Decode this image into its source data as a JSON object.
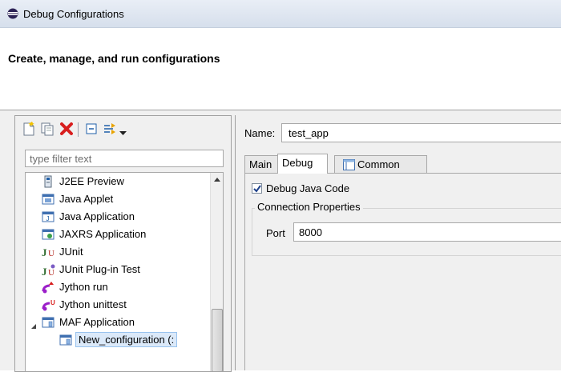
{
  "window": {
    "title": "Debug Configurations"
  },
  "header": {
    "heading": "Create, manage, and run configurations"
  },
  "left": {
    "filter_placeholder": "type filter text",
    "tree": [
      {
        "label": "J2EE Preview",
        "icon": "j2ee-preview-icon"
      },
      {
        "label": "Java Applet",
        "icon": "java-applet-icon"
      },
      {
        "label": "Java Application",
        "icon": "java-application-icon"
      },
      {
        "label": "JAXRS Application",
        "icon": "jaxrs-application-icon"
      },
      {
        "label": "JUnit",
        "icon": "junit-icon"
      },
      {
        "label": "JUnit Plug-in Test",
        "icon": "junit-plugin-test-icon"
      },
      {
        "label": "Jython run",
        "icon": "jython-run-icon"
      },
      {
        "label": "Jython unittest",
        "icon": "jython-unittest-icon"
      },
      {
        "label": "MAF Application",
        "icon": "maf-application-icon"
      },
      {
        "label": "New_configuration (:",
        "icon": "maf-configuration-icon"
      }
    ]
  },
  "right": {
    "name_label": "Name:",
    "name_value": "test_app",
    "tabs": [
      {
        "label": "Main"
      },
      {
        "label": "Debug"
      },
      {
        "label": "Common"
      }
    ],
    "debug_java_code_label": "Debug Java Code",
    "debug_java_code_checked": true,
    "connection_group_label": "Connection Properties",
    "port_label": "Port",
    "port_value": "8000"
  },
  "colors": {
    "selection": "#dbe9f9",
    "accent": "#1f5fa8",
    "delete": "#d81e1e",
    "jython": "#9b1fc9"
  }
}
